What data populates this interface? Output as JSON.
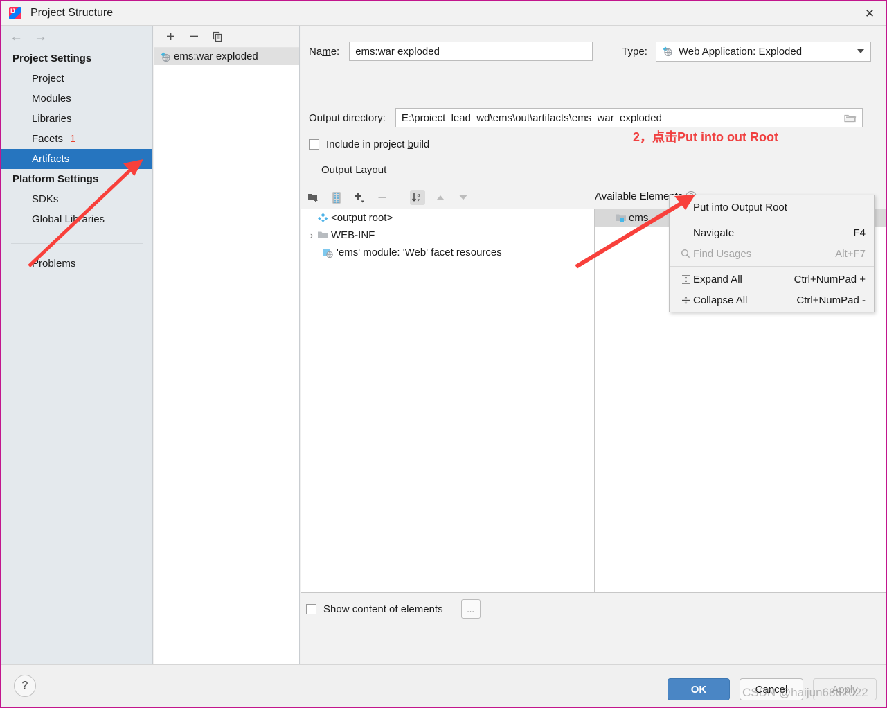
{
  "window": {
    "title": "Project Structure",
    "app_icon": "intellij-idea-icon",
    "close_icon": "close-icon",
    "border_color": "#c2168d"
  },
  "nav": {
    "back_icon": "arrow-left-icon",
    "forward_icon": "arrow-right-icon"
  },
  "sidebar": {
    "groups": [
      {
        "label": "Project Settings",
        "items": [
          {
            "label": "Project",
            "selected": false,
            "badge": ""
          },
          {
            "label": "Modules",
            "selected": false,
            "badge": ""
          },
          {
            "label": "Libraries",
            "selected": false,
            "badge": ""
          },
          {
            "label": "Facets",
            "selected": false,
            "badge": "1"
          },
          {
            "label": "Artifacts",
            "selected": true,
            "badge": ""
          }
        ]
      },
      {
        "label": "Platform Settings",
        "items": [
          {
            "label": "SDKs",
            "selected": false,
            "badge": ""
          },
          {
            "label": "Global Libraries",
            "selected": false,
            "badge": ""
          }
        ]
      }
    ],
    "problems": "Problems"
  },
  "artifacts_panel": {
    "toolbar": [
      {
        "name": "add-artifact-button",
        "glyph": "+"
      },
      {
        "name": "remove-artifact-button",
        "glyph": "−"
      },
      {
        "name": "copy-artifact-button",
        "glyph": "copy-icon"
      }
    ],
    "items": [
      {
        "label": "ems:war exploded",
        "icon": "web-artifact-icon",
        "selected": true
      }
    ]
  },
  "editor": {
    "name_label": "Name:",
    "name_label_pre": "Na",
    "name_label_mnemonic": "m",
    "name_label_post": "e:",
    "name_value": "ems:war exploded",
    "type_label": "Type:",
    "type_value": "Web Application: Exploded",
    "type_icon": "web-artifact-icon",
    "output_dir_label": "Output directory:",
    "output_dir_value": "E:\\proiect_lead_wd\\ems\\out\\artifacts\\ems_war_exploded",
    "browse_icon": "folder-icon",
    "include_build_pre": "Include in project ",
    "include_build_mnemonic": "b",
    "include_build_post": "uild",
    "include_build_checked": false,
    "output_layout_label": "Output Layout",
    "tree_toolbar": [
      {
        "name": "add-directory-button",
        "icon": "folder-plus-icon"
      },
      {
        "name": "add-archive-button",
        "icon": "archive-icon"
      },
      {
        "name": "add-element-button",
        "icon": "plus-dropdown-icon"
      },
      {
        "name": "remove-element-button",
        "icon": "minus-icon"
      },
      {
        "name": "sort-alphabetically-button",
        "icon": "sort-az-icon",
        "active": true
      },
      {
        "name": "move-up-button",
        "icon": "arrow-up-icon"
      },
      {
        "name": "move-down-button",
        "icon": "arrow-down-icon"
      }
    ],
    "output_tree": [
      {
        "label": "<output root>",
        "icon": "output-root-icon",
        "indent": 0,
        "twisty": ""
      },
      {
        "label": "WEB-INF",
        "icon": "folder-icon",
        "indent": 0,
        "twisty": "›"
      },
      {
        "label": "'ems' module: 'Web' facet resources",
        "icon": "web-facet-icon",
        "indent": 1,
        "twisty": ""
      }
    ],
    "available_elements_label": "Available Elements",
    "available_help_icon": "help-icon",
    "available_tree": [
      {
        "label": "ems",
        "icon": "module-icon",
        "selected": true
      }
    ],
    "show_content_label": "Show content of elements",
    "show_content_checked": false,
    "show_content_more": "..."
  },
  "context_menu": {
    "items": [
      {
        "label": "Put into Output Root",
        "shortcut": "",
        "icon": "",
        "disabled": false
      },
      {
        "sep": true
      },
      {
        "label": "Navigate",
        "shortcut": "F4",
        "icon": "",
        "disabled": false
      },
      {
        "label": "Find Usages",
        "shortcut": "Alt+F7",
        "icon": "search-icon",
        "disabled": true
      },
      {
        "sep": true
      },
      {
        "label": "Expand All",
        "shortcut": "Ctrl+NumPad +",
        "icon": "expand-all-icon",
        "disabled": false
      },
      {
        "label": "Collapse All",
        "shortcut": "Ctrl+NumPad -",
        "icon": "collapse-all-icon",
        "disabled": false
      }
    ]
  },
  "footer": {
    "help_glyph": "?",
    "ok_label": "OK",
    "cancel_label": "Cancel",
    "apply_label": "Apply",
    "ok_color": "#4a86c5"
  },
  "annotations": {
    "step1_badge": "1",
    "step2_text": "2，点击Put into out Root",
    "arrow_color": "#f8403b"
  },
  "watermark": {
    "text": "CSDN @haijun6862022"
  }
}
